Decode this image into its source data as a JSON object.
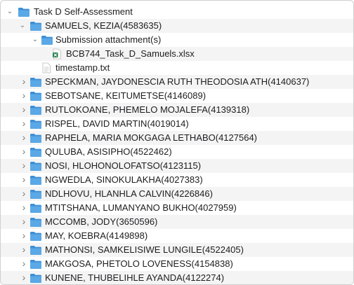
{
  "root": {
    "label": "Task D Self-Assessment",
    "icon": "folder-icon",
    "expanded": true
  },
  "expanded_student": {
    "label": "SAMUELS, KEZIA(4583635)",
    "icon": "folder-icon",
    "children": {
      "submission_folder": {
        "label": "Submission attachment(s)",
        "icon": "folder-icon",
        "file": {
          "label": "BCB744_Task_D_Samuels.xlsx",
          "icon": "excel-file-icon"
        }
      },
      "timestamp": {
        "label": "timestamp.txt",
        "icon": "text-file-icon"
      }
    }
  },
  "students": [
    {
      "label": "SPECKMAN, JAYDONESCIA RUTH THEODOSIA ATH(4140637)"
    },
    {
      "label": "SEBOTSANE, KEITUMETSE(4146089)"
    },
    {
      "label": "RUTLOKOANE, PHEMELO MOJALEFA(4139318)"
    },
    {
      "label": "RISPEL, DAVID MARTIN(4019014)"
    },
    {
      "label": "RAPHELA, MARIA MOKGAGA LETHABO(4127564)"
    },
    {
      "label": "QULUBA, ASISIPHO(4522462)"
    },
    {
      "label": "NOSI, HLOHONOLOFATSO(4123115)"
    },
    {
      "label": "NGWEDLA, SINOKULAKHA(4027383)"
    },
    {
      "label": "NDLHOVU, HLANHLA CALVIN(4226846)"
    },
    {
      "label": "MTITSHANA, LUMANYANO BUKHO(4027959)"
    },
    {
      "label": "MCCOMB, JODY(3650596)"
    },
    {
      "label": "MAY, KOEBRA(4149898)"
    },
    {
      "label": "MATHONSI, SAMKELISIWE LUNGILE(4522405)"
    },
    {
      "label": "MAKGOSA, PHETOLO LOVENESS(4154838)"
    },
    {
      "label": "KUNENE, THUBELIHLE AYANDA(4122274)"
    }
  ],
  "colors": {
    "folder": "#5aa8e6",
    "folder_dark": "#3d8fd6",
    "excel": "#1e7b45",
    "row_alt": "#f4f4f5"
  }
}
